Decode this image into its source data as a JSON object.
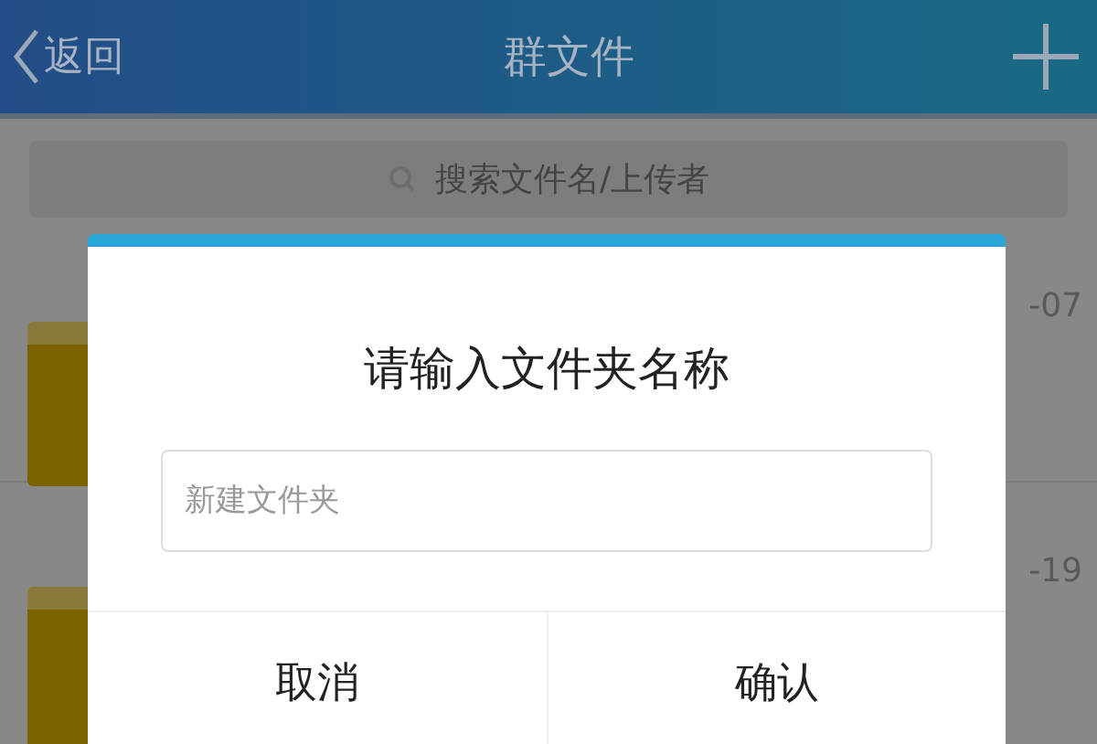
{
  "nav_bar": {
    "back_label": "返回",
    "title": "群文件"
  },
  "search": {
    "placeholder": "搜索文件名/上传者"
  },
  "files": [
    {
      "date": "-07"
    },
    {
      "date": "-19"
    }
  ],
  "dialog": {
    "title": "请输入文件夹名称",
    "input": {
      "placeholder": "新建文件夹"
    },
    "buttons": [
      "取消",
      "确认"
    ]
  }
}
